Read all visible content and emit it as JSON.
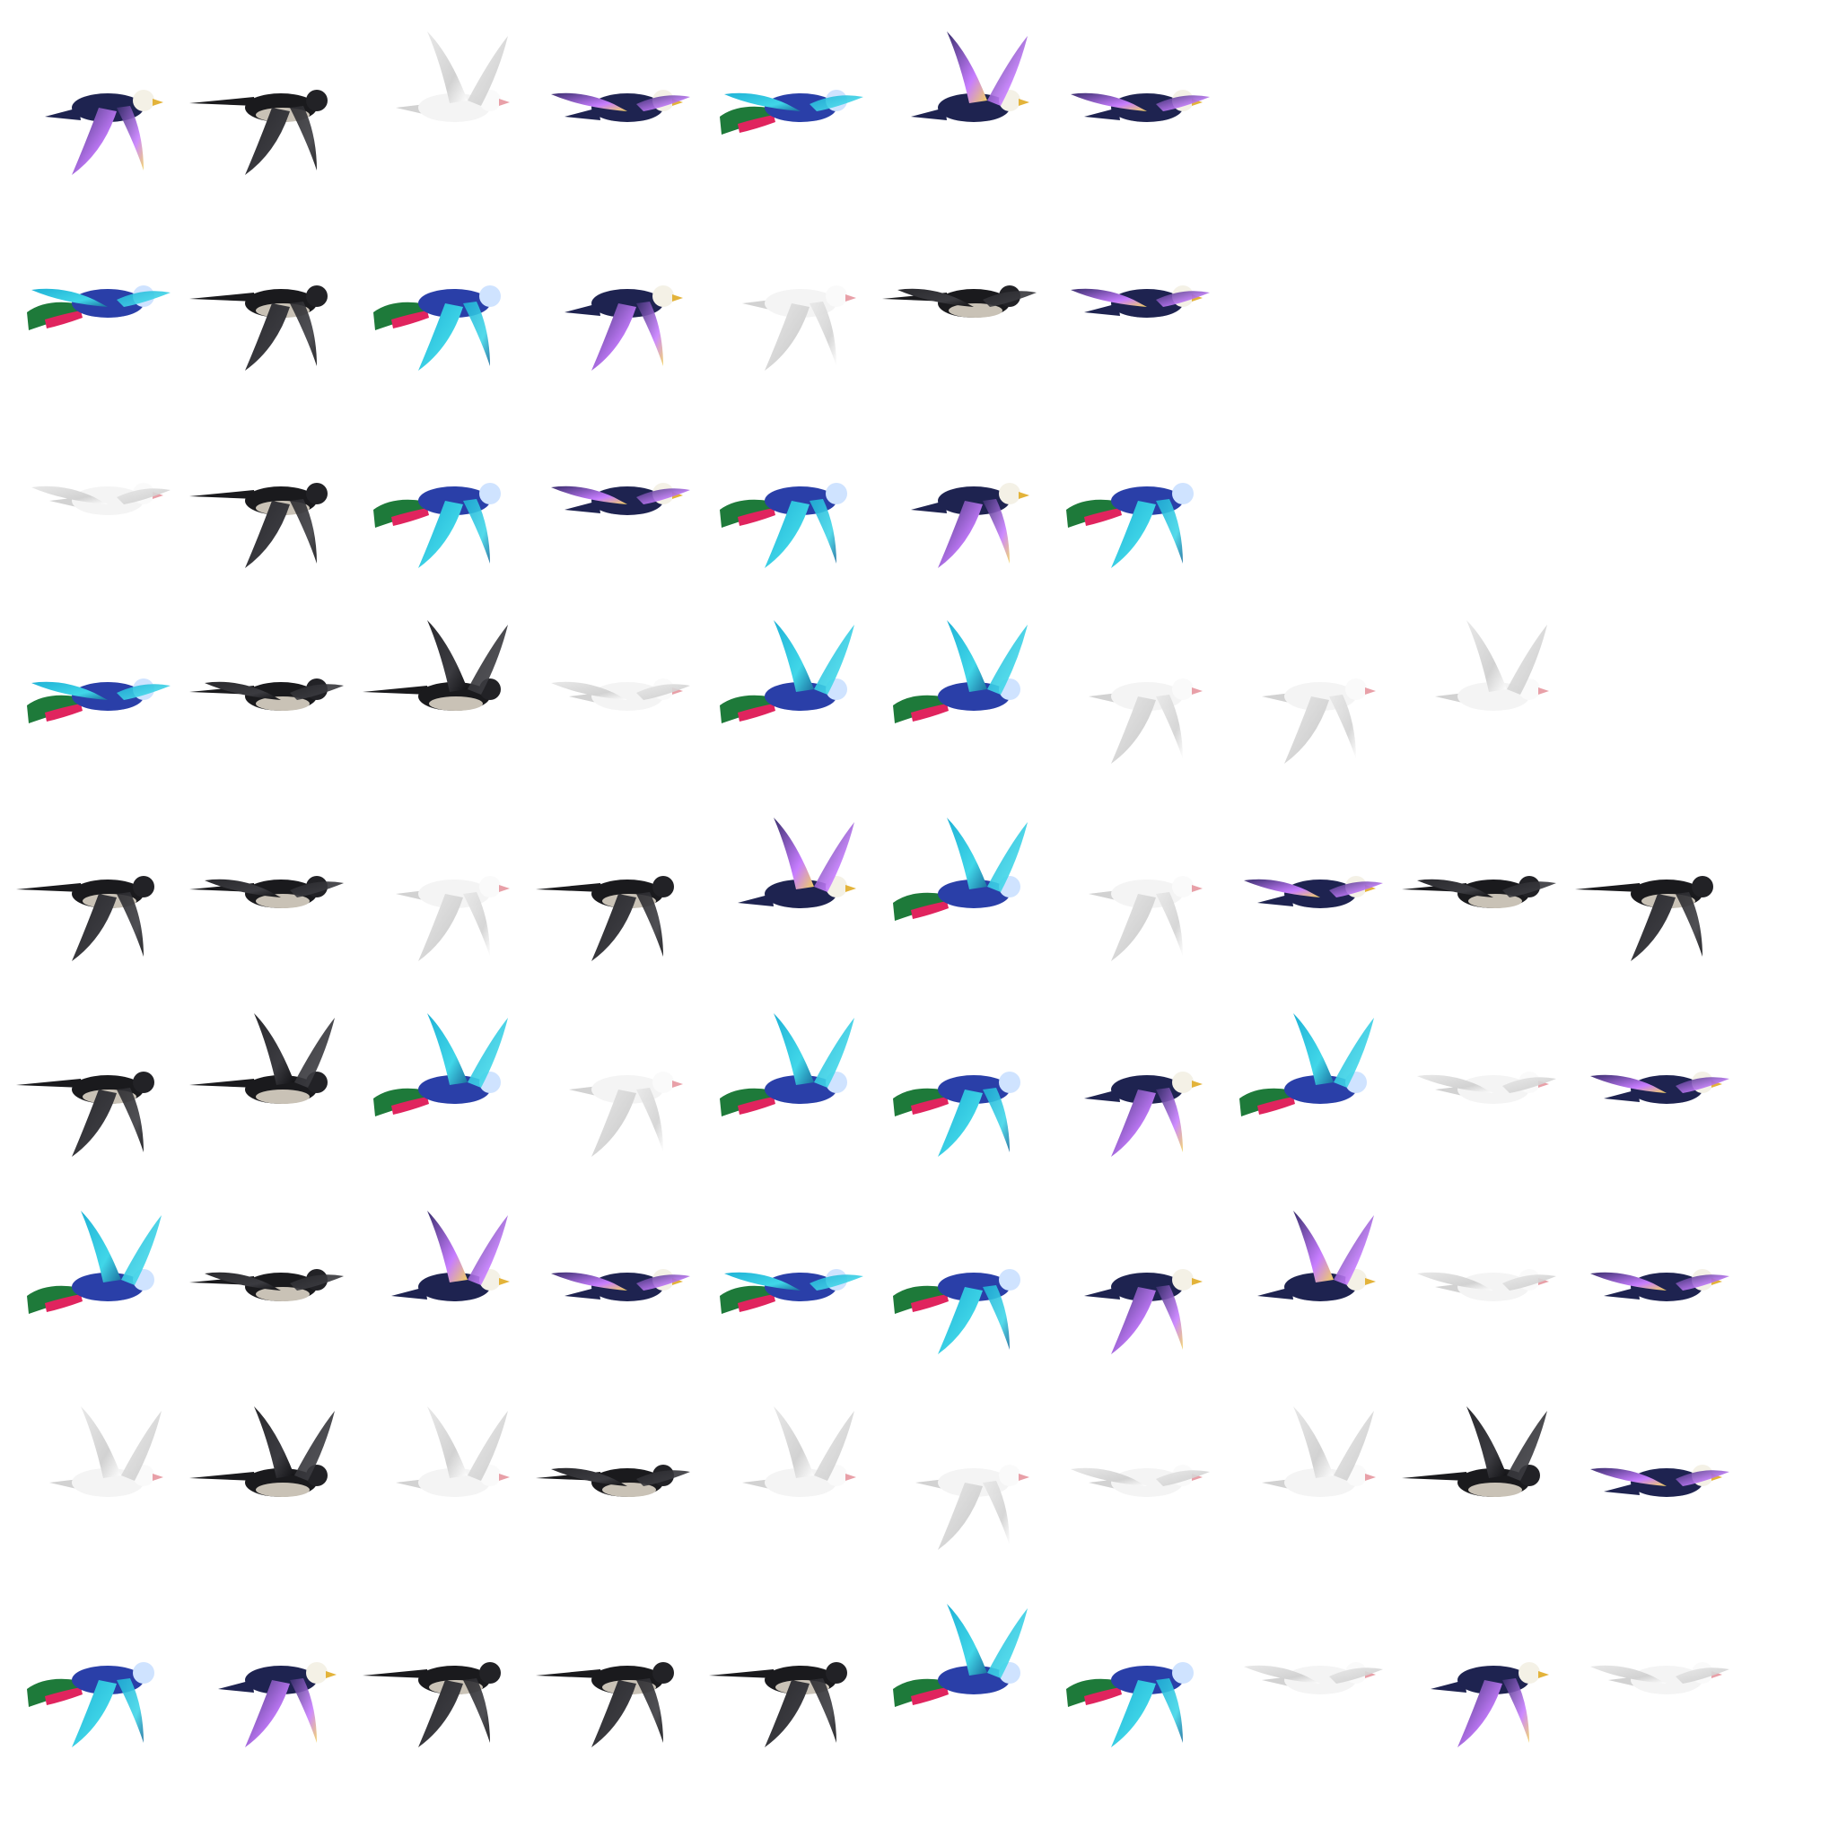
{
  "sheet": {
    "background": "#ffffff",
    "rows": [
      {
        "cells": [
          {
            "species": "eagle",
            "pose": "down",
            "flip": false
          },
          {
            "species": "swallow",
            "pose": "down",
            "flip": false
          },
          {
            "species": "dove",
            "pose": "up",
            "flip": false
          },
          {
            "species": "eagle",
            "pose": "glide",
            "flip": false
          },
          {
            "species": "peacock",
            "pose": "glide",
            "flip": false
          },
          {
            "species": "eagle",
            "pose": "up",
            "flip": false
          },
          {
            "species": "eagle",
            "pose": "glide",
            "flip": false
          }
        ]
      },
      {
        "cells": [
          {
            "species": "peacock",
            "pose": "glide",
            "flip": false
          },
          {
            "species": "swallow",
            "pose": "down",
            "flip": false
          },
          {
            "species": "peacock",
            "pose": "down",
            "flip": false
          },
          {
            "species": "eagle",
            "pose": "down",
            "flip": false
          },
          {
            "species": "dove",
            "pose": "down",
            "flip": false
          },
          {
            "species": "swallow",
            "pose": "glide",
            "flip": false
          },
          {
            "species": "eagle",
            "pose": "glide",
            "flip": false
          }
        ]
      },
      {
        "cells": [
          {
            "species": "dove",
            "pose": "glide",
            "flip": false
          },
          {
            "species": "swallow",
            "pose": "down",
            "flip": false
          },
          {
            "species": "peacock",
            "pose": "down",
            "flip": false
          },
          {
            "species": "eagle",
            "pose": "glide",
            "flip": false
          },
          {
            "species": "peacock",
            "pose": "down",
            "flip": false
          },
          {
            "species": "eagle",
            "pose": "down",
            "flip": false
          },
          {
            "species": "peacock",
            "pose": "down",
            "flip": false
          }
        ]
      },
      {
        "cells": [
          {
            "species": "peacock",
            "pose": "glide",
            "flip": false
          },
          {
            "species": "swallow",
            "pose": "glide",
            "flip": false
          },
          {
            "species": "swallow",
            "pose": "up",
            "flip": false
          },
          {
            "species": "dove",
            "pose": "glide",
            "flip": false
          },
          {
            "species": "peacock",
            "pose": "up",
            "flip": false
          },
          {
            "species": "peacock",
            "pose": "up",
            "flip": false
          },
          {
            "species": "dove",
            "pose": "down",
            "flip": false
          },
          {
            "species": "dove",
            "pose": "down",
            "flip": false
          },
          {
            "species": "dove",
            "pose": "up",
            "flip": false
          }
        ]
      },
      {
        "cells": [
          {
            "species": "swallow",
            "pose": "down",
            "flip": false
          },
          {
            "species": "swallow",
            "pose": "glide",
            "flip": false
          },
          {
            "species": "dove",
            "pose": "down",
            "flip": false
          },
          {
            "species": "swallow",
            "pose": "down",
            "flip": false
          },
          {
            "species": "eagle",
            "pose": "up",
            "flip": false
          },
          {
            "species": "peacock",
            "pose": "up",
            "flip": false
          },
          {
            "species": "dove",
            "pose": "down",
            "flip": false
          },
          {
            "species": "eagle",
            "pose": "glide",
            "flip": false
          },
          {
            "species": "swallow",
            "pose": "glide",
            "flip": false
          },
          {
            "species": "swallow",
            "pose": "down",
            "flip": false
          }
        ]
      },
      {
        "cells": [
          {
            "species": "swallow",
            "pose": "down",
            "flip": false
          },
          {
            "species": "swallow",
            "pose": "up",
            "flip": false
          },
          {
            "species": "peacock",
            "pose": "up",
            "flip": false
          },
          {
            "species": "dove",
            "pose": "down",
            "flip": false
          },
          {
            "species": "peacock",
            "pose": "up",
            "flip": false
          },
          {
            "species": "peacock",
            "pose": "down",
            "flip": false
          },
          {
            "species": "eagle",
            "pose": "down",
            "flip": false
          },
          {
            "species": "peacock",
            "pose": "up",
            "flip": false
          },
          {
            "species": "dove",
            "pose": "glide",
            "flip": false
          },
          {
            "species": "eagle",
            "pose": "glide",
            "flip": false
          }
        ]
      },
      {
        "cells": [
          {
            "species": "peacock",
            "pose": "up",
            "flip": false
          },
          {
            "species": "swallow",
            "pose": "glide",
            "flip": false
          },
          {
            "species": "eagle",
            "pose": "up",
            "flip": false
          },
          {
            "species": "eagle",
            "pose": "glide",
            "flip": false
          },
          {
            "species": "peacock",
            "pose": "glide",
            "flip": false
          },
          {
            "species": "peacock",
            "pose": "down",
            "flip": false
          },
          {
            "species": "eagle",
            "pose": "down",
            "flip": false
          },
          {
            "species": "eagle",
            "pose": "up",
            "flip": false
          },
          {
            "species": "dove",
            "pose": "glide",
            "flip": false
          },
          {
            "species": "eagle",
            "pose": "glide",
            "flip": false
          }
        ]
      },
      {
        "cells": [
          {
            "species": "dove",
            "pose": "up",
            "flip": false
          },
          {
            "species": "swallow",
            "pose": "up",
            "flip": false
          },
          {
            "species": "dove",
            "pose": "up",
            "flip": false
          },
          {
            "species": "swallow",
            "pose": "glide",
            "flip": false
          },
          {
            "species": "dove",
            "pose": "up",
            "flip": false
          },
          {
            "species": "dove",
            "pose": "down",
            "flip": false
          },
          {
            "species": "dove",
            "pose": "glide",
            "flip": false
          },
          {
            "species": "dove",
            "pose": "up",
            "flip": false
          },
          {
            "species": "swallow",
            "pose": "up",
            "flip": false
          },
          {
            "species": "eagle",
            "pose": "glide",
            "flip": false
          }
        ]
      },
      {
        "cells": [
          {
            "species": "peacock",
            "pose": "down",
            "flip": false
          },
          {
            "species": "eagle",
            "pose": "down",
            "flip": false
          },
          {
            "species": "swallow",
            "pose": "down",
            "flip": false
          },
          {
            "species": "swallow",
            "pose": "down",
            "flip": false
          },
          {
            "species": "swallow",
            "pose": "down",
            "flip": false
          },
          {
            "species": "peacock",
            "pose": "up",
            "flip": false
          },
          {
            "species": "peacock",
            "pose": "down",
            "flip": false
          },
          {
            "species": "dove",
            "pose": "glide",
            "flip": false
          },
          {
            "species": "eagle",
            "pose": "down",
            "flip": false
          },
          {
            "species": "dove",
            "pose": "glide",
            "flip": false
          }
        ]
      }
    ]
  },
  "palette": {
    "eagle": {
      "body": "#1e2350",
      "wing": "#3a2f6e",
      "tip1": "#c77dff",
      "tip2": "#f2d35c",
      "head": "#f4f1e6",
      "beak": "#e3b33a"
    },
    "swallow": {
      "body": "#1a1a1d",
      "wing": "#2a2a2e",
      "tip1": "#3b3b40",
      "tip2": "#111114",
      "head": "#222226",
      "belly": "#c9c2b6"
    },
    "dove": {
      "body": "#f4f4f4",
      "wing": "#e8e8e8",
      "tip1": "#d2d2d2",
      "tip2": "#ffffff",
      "head": "#fafafa",
      "beak": "#e8a0a8"
    },
    "peacock": {
      "body": "#2a3fa8",
      "wing": "#1fb2d6",
      "tip1": "#40d6e8",
      "tip2": "#1a6e9e",
      "tail": "#1e7a3a",
      "ribbon": "#e0245e",
      "head": "#cfe3ff"
    }
  }
}
